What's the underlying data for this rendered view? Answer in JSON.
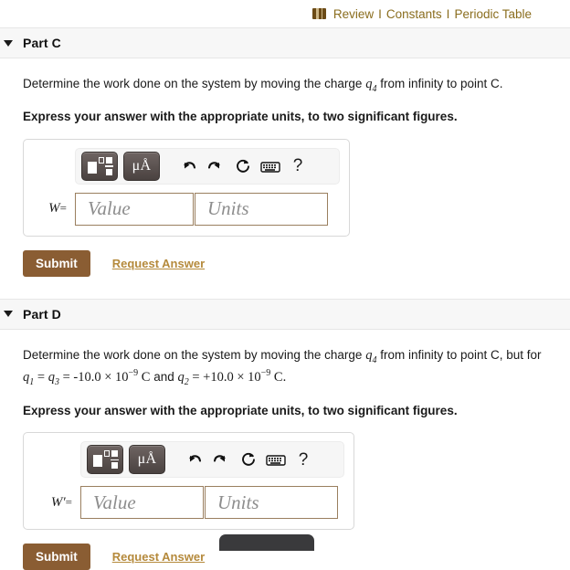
{
  "resources": {
    "book_icon": "book-icon",
    "links": [
      {
        "label": "Review"
      },
      {
        "label": "Constants"
      },
      {
        "label": "Periodic Table"
      }
    ],
    "separator": "I"
  },
  "parts": [
    {
      "id": "part-c",
      "title": "Part C",
      "caret_icon": "caret-down-icon",
      "question_pre": "Determine the work done on the system by moving the charge ",
      "question_var": "q",
      "question_var_sub": "4",
      "question_post": " from infinity to point C.",
      "has_second_line": false,
      "instruction": "Express your answer with the appropriate units, to two significant figures.",
      "toolbar": {
        "template_button": "math-template-button",
        "template_icon": "math-template-icon",
        "units_button": "units-button",
        "units_label": "μÅ",
        "undo_icon": "undo-icon",
        "redo_icon": "redo-icon",
        "reset_icon": "reset-icon",
        "keyboard_icon": "keyboard-icon",
        "help_label": "?"
      },
      "answer": {
        "variable": "W",
        "prime": "",
        "equals": "=",
        "value_placeholder": "Value",
        "units_placeholder": "Units",
        "value": "",
        "units": ""
      },
      "submit_label": "Submit",
      "request_answer_label": "Request Answer"
    },
    {
      "id": "part-d",
      "title": "Part D",
      "caret_icon": "caret-down-icon",
      "question_pre": "Determine the work done on the system by moving the charge ",
      "question_var": "q",
      "question_var_sub": "4",
      "question_post": " from infinity to point C, but for",
      "has_second_line": true,
      "second_line": {
        "q1": "q",
        "q1_sub": "1",
        "eq1": " = ",
        "q3": "q",
        "q3_sub": "3",
        "eq2": " = ",
        "val1": "-10.0 × 10",
        "exp1": "−9",
        "unit1": " C",
        "conj": " and ",
        "q2": "q",
        "q2_sub": "2",
        "eq3": " = ",
        "val2": "+10.0 × 10",
        "exp2": "−9",
        "unit2": " C."
      },
      "instruction": "Express your answer with the appropriate units, to two significant figures.",
      "toolbar": {
        "template_button": "math-template-button",
        "template_icon": "math-template-icon",
        "units_button": "units-button",
        "units_label": "μÅ",
        "undo_icon": "undo-icon",
        "redo_icon": "redo-icon",
        "reset_icon": "reset-icon",
        "keyboard_icon": "keyboard-icon",
        "help_label": "?"
      },
      "answer": {
        "variable": "W",
        "prime": "′",
        "equals": "=",
        "value_placeholder": "Value",
        "units_placeholder": "Units",
        "value": "",
        "units": ""
      },
      "submit_label": "Submit",
      "request_answer_label": "Request Answer"
    }
  ],
  "colors": {
    "submit_bg": "#8a5d33",
    "link_gold": "#b58a3c",
    "resource_link": "#8a6d1e",
    "header_bg": "#f7f7f7",
    "input_border": "#9a7f5f",
    "tooltip_bg": "#3a3a3c"
  }
}
